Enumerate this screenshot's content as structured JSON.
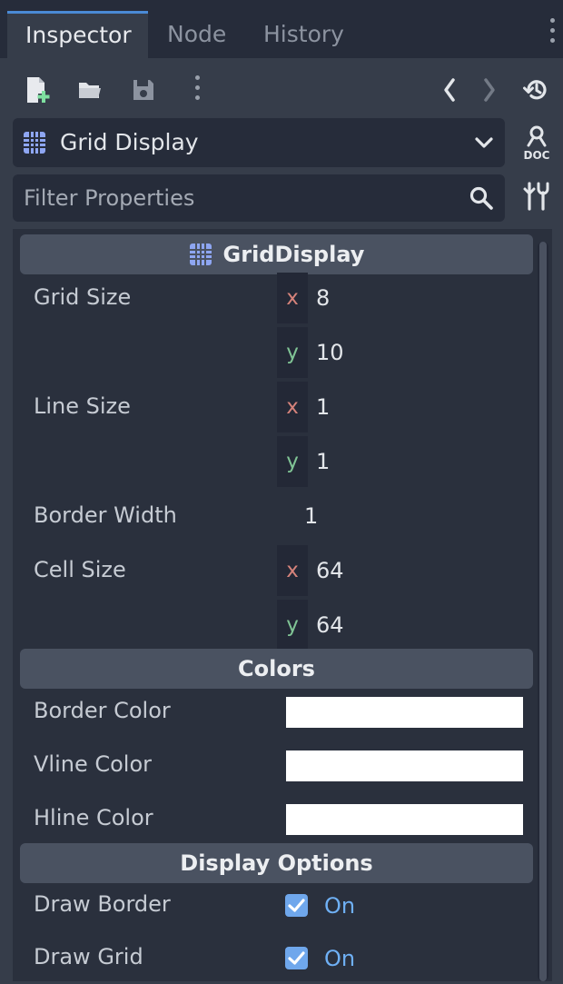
{
  "tabs": [
    {
      "label": "Inspector"
    },
    {
      "label": "Node"
    },
    {
      "label": "History"
    }
  ],
  "object": {
    "name": "Grid Display"
  },
  "filter": {
    "placeholder": "Filter Properties"
  },
  "sections": {
    "grid_display": {
      "title": "GridDisplay"
    },
    "colors": {
      "title": "Colors"
    },
    "display_options": {
      "title": "Display Options"
    }
  },
  "properties": {
    "grid_size": {
      "label": "Grid Size",
      "x_axis": "x",
      "x": "8",
      "y_axis": "y",
      "y": "10"
    },
    "line_size": {
      "label": "Line Size",
      "x_axis": "x",
      "x": "1",
      "y_axis": "y",
      "y": "1"
    },
    "border_width": {
      "label": "Border Width",
      "value": "1"
    },
    "cell_size": {
      "label": "Cell Size",
      "x_axis": "x",
      "x": "64",
      "y_axis": "y",
      "y": "64"
    },
    "border_color": {
      "label": "Border Color",
      "color": "#ffffff"
    },
    "vline_color": {
      "label": "Vline Color",
      "color": "#ffffff"
    },
    "hline_color": {
      "label": "Hline Color",
      "color": "#ffffff"
    },
    "draw_border": {
      "label": "Draw Border",
      "state": "On",
      "checked": true
    },
    "draw_grid": {
      "label": "Draw Grid",
      "state": "On",
      "checked": true
    }
  },
  "icons": {
    "new_script": "new-script-icon",
    "open": "open-folder-icon",
    "save": "save-icon",
    "more": "more-vertical-icon",
    "back": "chevron-left-icon",
    "forward": "chevron-right-icon",
    "history": "history-icon",
    "grid": "grid-icon",
    "doc": "doc-icon",
    "search": "search-icon",
    "tools": "tools-icon"
  },
  "colors": {
    "accent": "#4a8ad6",
    "check": "#6fa7ec",
    "x_axis": "#d6837b",
    "y_axis": "#80c495",
    "icon_grid": "#8ea6f2"
  }
}
